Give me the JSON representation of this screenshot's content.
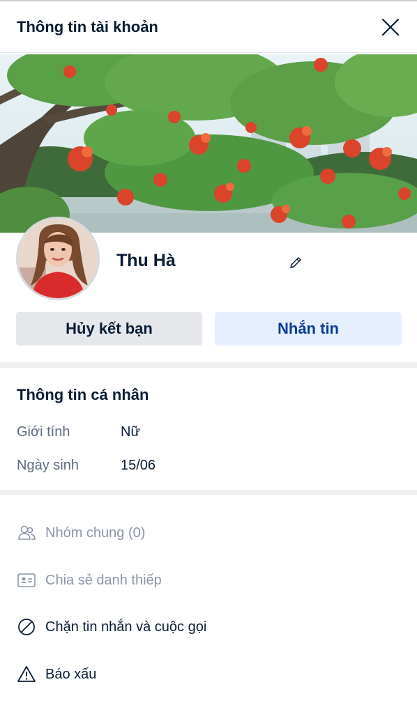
{
  "header": {
    "title": "Thông tin tài khoản"
  },
  "profile": {
    "name": "Thu Hà"
  },
  "buttons": {
    "unfriend": "Hủy kết bạn",
    "message": "Nhắn tin"
  },
  "personal_info": {
    "title": "Thông tin cá nhân",
    "rows": [
      {
        "label": "Giới tính",
        "value": "Nữ"
      },
      {
        "label": "Ngày sinh",
        "value": "15/06"
      }
    ]
  },
  "actions": [
    {
      "label": "Nhóm chung (0)",
      "icon": "group-icon"
    },
    {
      "label": "Chia sẻ danh thiếp",
      "icon": "contact-card-icon"
    },
    {
      "label": "Chặn tin nhắn và cuộc gọi",
      "icon": "block-icon"
    },
    {
      "label": "Báo xấu",
      "icon": "warning-icon"
    }
  ],
  "colors": {
    "primary_text": "#081c36",
    "accent_blue": "#0a3d91",
    "accent_bg": "#e5efff",
    "muted": "#8a95a6"
  }
}
